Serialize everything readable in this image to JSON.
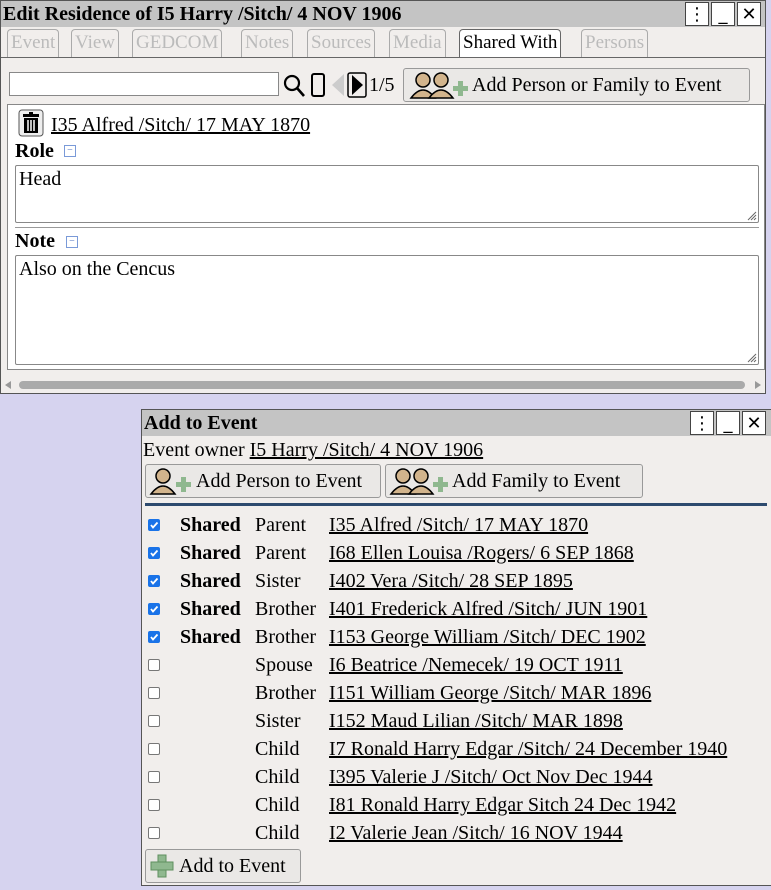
{
  "edit_window": {
    "title": "Edit Residence of I5 Harry /Sitch/ 4 NOV 1906",
    "tabs": [
      "Event",
      "View",
      "GEDCOM",
      "Notes",
      "Sources",
      "Media",
      "Shared With",
      "Persons"
    ],
    "active_tab": "Shared With",
    "pager": "1/5",
    "search_value": "",
    "add_button": "Add Person or Family to Event",
    "person_link": "I35 Alfred /Sitch/ 17 MAY 1870",
    "role_label": "Role",
    "role_value": "Head",
    "note_label": "Note",
    "note_value": "Also on the Cencus"
  },
  "add_window": {
    "title": "Add to Event",
    "owner_label": "Event owner",
    "owner_link": "I5 Harry /Sitch/ 4 NOV 1906",
    "add_person_button": "Add Person to Event",
    "add_family_button": "Add Family to Event",
    "rows": [
      {
        "checked": true,
        "shared": "Shared",
        "relation": "Parent",
        "name": "I35 Alfred /Sitch/ 17 MAY 1870"
      },
      {
        "checked": true,
        "shared": "Shared",
        "relation": "Parent",
        "name": "I68 Ellen Louisa /Rogers/ 6 SEP 1868"
      },
      {
        "checked": true,
        "shared": "Shared",
        "relation": "Sister",
        "name": "I402 Vera /Sitch/ 28 SEP 1895"
      },
      {
        "checked": true,
        "shared": "Shared",
        "relation": "Brother",
        "name": "I401 Frederick Alfred /Sitch/ JUN 1901"
      },
      {
        "checked": true,
        "shared": "Shared",
        "relation": "Brother",
        "name": "I153 George William /Sitch/ DEC 1902"
      },
      {
        "checked": false,
        "shared": "",
        "relation": "Spouse",
        "name": "I6 Beatrice /Nemecek/ 19 OCT 1911"
      },
      {
        "checked": false,
        "shared": "",
        "relation": "Brother",
        "name": "I151 William George /Sitch/ MAR 1896"
      },
      {
        "checked": false,
        "shared": "",
        "relation": "Sister",
        "name": "I152 Maud Lilian /Sitch/ MAR 1898"
      },
      {
        "checked": false,
        "shared": "",
        "relation": "Child",
        "name": "I7 Ronald Harry Edgar /Sitch/ 24 December 1940"
      },
      {
        "checked": false,
        "shared": "",
        "relation": "Child",
        "name": "I395 Valerie J /Sitch/ Oct Nov Dec 1944"
      },
      {
        "checked": false,
        "shared": "",
        "relation": "Child",
        "name": "I81 Ronald Harry Edgar Sitch 24 Dec 1942"
      },
      {
        "checked": false,
        "shared": "",
        "relation": "Child",
        "name": "I2 Valerie Jean /Sitch/ 16 NOV 1944"
      }
    ],
    "add_to_event_button": "Add to Event"
  },
  "colors": {
    "checkbox_accent": "#1a73e8",
    "titlebar": "#c4c4c4",
    "background": "#d6d3ef"
  }
}
